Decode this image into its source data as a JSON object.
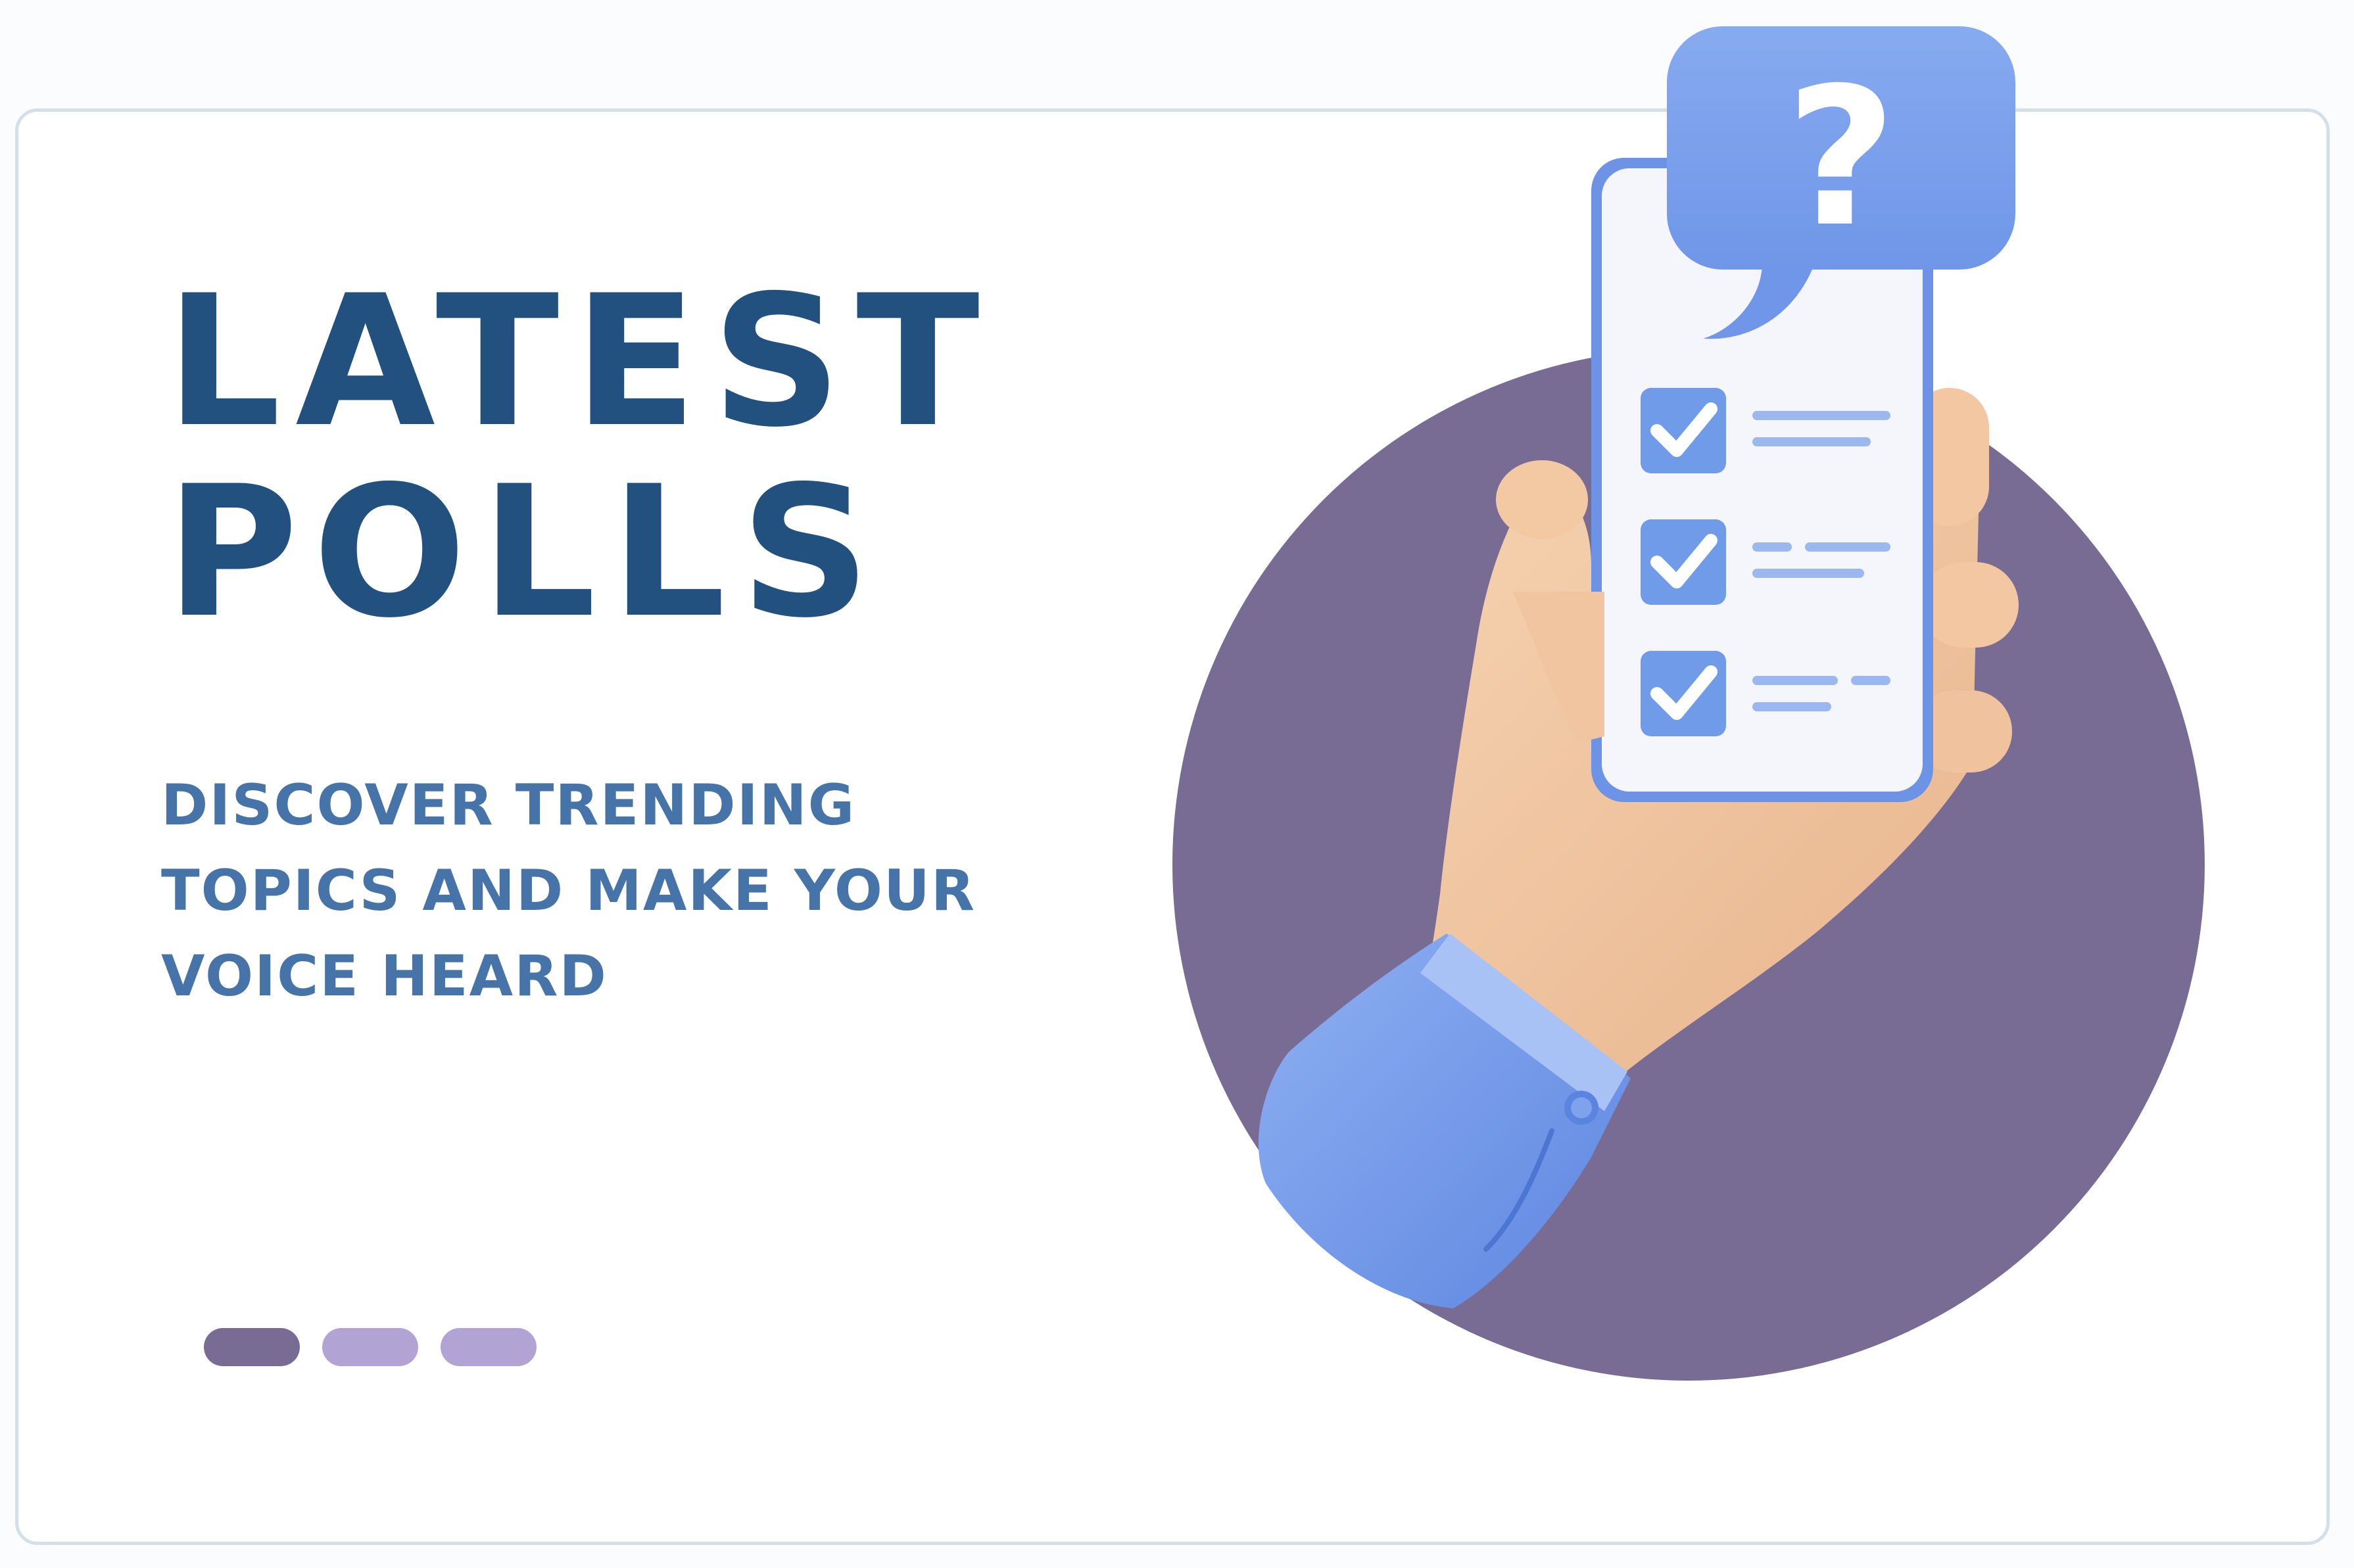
{
  "banner": {
    "title_line1": "LATEST",
    "title_line2": "POLLS",
    "subtitle_line1": "DISCOVER TRENDING",
    "subtitle_line2": "TOPICS AND MAKE YOUR",
    "subtitle_line3": "VOICE HEARD"
  },
  "carousel": {
    "slide_count": 3,
    "active_index": 0
  },
  "colors": {
    "title": "#23517f",
    "subtitle": "#4774a8",
    "circle": "#786c95",
    "dot_active": "#786c95",
    "dot_inactive": "#b1a4d4",
    "card_border": "#d3e0e8",
    "accent_blue": "#6f9be9"
  },
  "illustration": {
    "icon_names": [
      "hand-icon",
      "phone-icon",
      "question-bubble-icon",
      "checkbox-icon",
      "sleeve-icon"
    ],
    "question_glyph": "?"
  }
}
